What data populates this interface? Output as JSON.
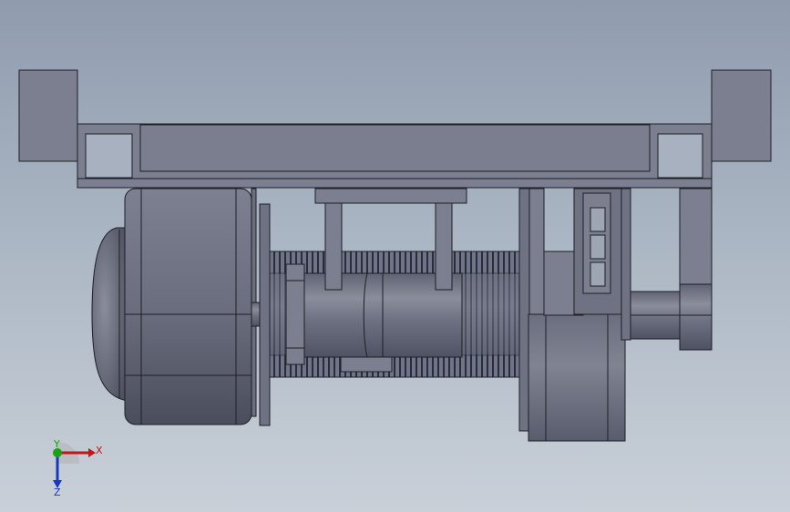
{
  "triad": {
    "x_label": "X",
    "y_label": "Y",
    "z_label": "Z",
    "x_color": "#c01818",
    "y_color": "#18a018",
    "z_color": "#1838c0"
  },
  "colors": {
    "part_fill": "#7b7f8f",
    "part_dark": "#5e6272",
    "part_light": "#9498a6",
    "edge": "#1e1f26"
  }
}
